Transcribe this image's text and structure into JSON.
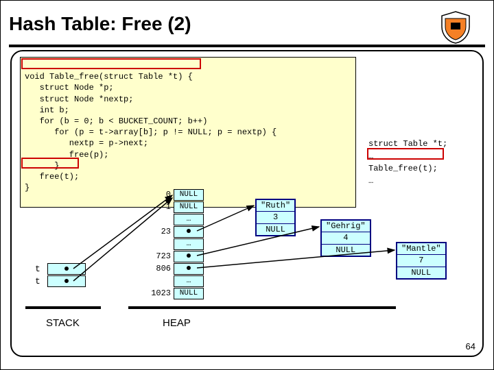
{
  "title": "Hash Table: Free (2)",
  "code": {
    "l1": "void Table_free(struct Table *t) {",
    "l2": "   struct Node *p;",
    "l3": "   struct Node *nextp;",
    "l4": "   int b;",
    "l5": "   for (b = 0; b < BUCKET_COUNT; b++)",
    "l6": "      for (p = t->array[b]; p != NULL; p = nextp) {",
    "l7": "         nextp = p->next;",
    "l8": "         free(p);",
    "l9": "      }",
    "l10": "   free(t);",
    "l11": "}"
  },
  "side": {
    "l1": "struct Table *t;",
    "l2": "…",
    "l3": "Table_free(t);",
    "l4": "…"
  },
  "buckets": {
    "i0": "0",
    "v0": "NULL",
    "i1": "1",
    "v1": "NULL",
    "i2": "",
    "v2": "…",
    "i3": "23",
    "v3_dot": true,
    "i4": "",
    "v4": "…",
    "i5": "723",
    "v5_dot": true,
    "i6": "806",
    "v6_dot": true,
    "i7": "",
    "v7": "…",
    "i8": "1023",
    "v8": "NULL"
  },
  "nodes": {
    "ruth": {
      "key": "\"Ruth\"",
      "val": "3",
      "next": "NULL"
    },
    "gehrig": {
      "key": "\"Gehrig\"",
      "val": "4",
      "next": "NULL"
    },
    "mantle": {
      "key": "\"Mantle\"",
      "val": "7",
      "next": "NULL"
    }
  },
  "stack": {
    "t1": "t",
    "t2": "t"
  },
  "labels": {
    "stack": "STACK",
    "heap": "HEAP"
  },
  "page": "64"
}
